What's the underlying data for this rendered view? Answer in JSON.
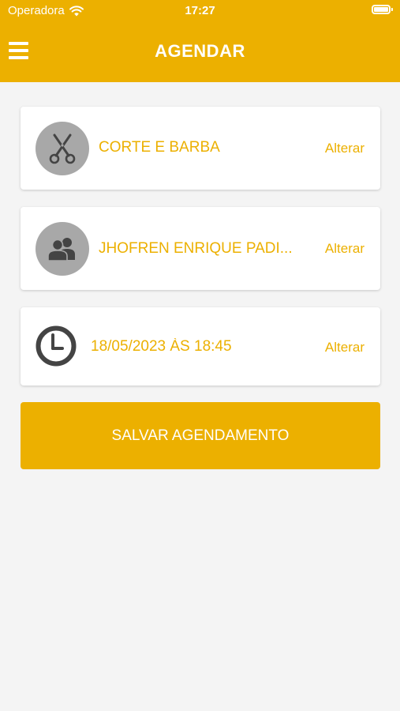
{
  "status_bar": {
    "carrier": "Operadora",
    "time": "17:27",
    "icons": [
      "wifi-icon",
      "battery-icon"
    ]
  },
  "header": {
    "title": "AGENDAR",
    "menu_icon": "hamburger-menu-icon"
  },
  "cards": [
    {
      "icon": "scissors-icon",
      "label": "CORTE E BARBA",
      "action": "Alterar"
    },
    {
      "icon": "people-icon",
      "label": "JHOFREN ENRIQUE PADI...",
      "action": "Alterar"
    },
    {
      "icon": "clock-icon",
      "label": "18/05/2023 ÀS 18:45",
      "action": "Alterar"
    }
  ],
  "save_button": {
    "label": "SALVAR AGENDAMENTO"
  },
  "colors": {
    "accent": "#ecb000",
    "background": "#f4f4f4",
    "card": "#ffffff",
    "avatar_bg": "#a8a8a8",
    "icon_dark": "#444444"
  }
}
